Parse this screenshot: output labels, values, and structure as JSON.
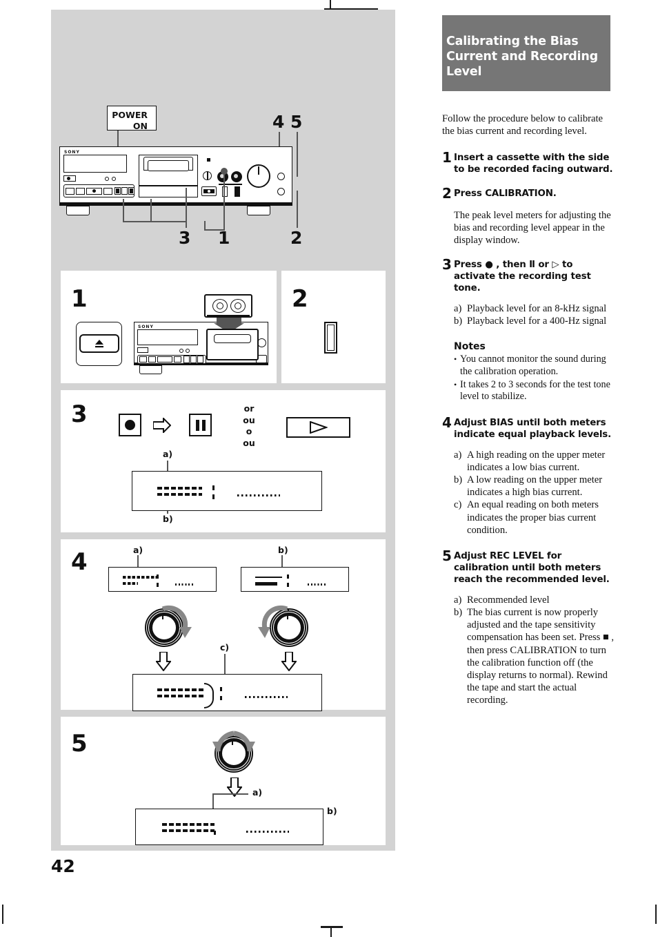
{
  "page": {
    "number": "42",
    "header_bg": "#767676",
    "panel_bg": "#d3d3d3"
  },
  "chapter": {
    "title": "Calibrating the Bias Current and Recording Level"
  },
  "intro": "Follow the procedure below to calibrate the bias current and recording level.",
  "steps": [
    {
      "n": "1",
      "title": "Insert a cassette with the side to be recorded facing outward."
    },
    {
      "n": "2",
      "title": "Press CALIBRATION.",
      "body": "The peak level meters for adjusting the bias and recording level appear in the display window."
    },
    {
      "n": "3",
      "title": "Press ● , then Ⅱ or ▷ to activate the recording test tone.",
      "sublist": [
        {
          "label": "a)",
          "text": "Playback level for an 8-kHz signal"
        },
        {
          "label": "b)",
          "text": "Playback level for a 400-Hz signal"
        }
      ]
    },
    {
      "n": "4",
      "title": "Adjust BIAS until both meters indicate equal playback levels.",
      "sublist": [
        {
          "label": "a)",
          "text": "A high reading on the upper meter indicates a low bias current."
        },
        {
          "label": "b)",
          "text": "A low reading on the upper meter indicates a high bias current."
        },
        {
          "label": "c)",
          "text": "An equal reading on both meters indicates the proper bias current condition."
        }
      ]
    },
    {
      "n": "5",
      "title": "Adjust REC LEVEL for calibration until both meters reach the recommended level.",
      "sublist": [
        {
          "label": "a)",
          "text": "Recommended level"
        },
        {
          "label": "b)",
          "text": "The bias current is now properly adjusted and the tape sensitivity compensation has been set. Press ■ , then press CALIBRATION to turn the calibration function off (the display returns to normal). Rewind the tape and start the actual recording."
        }
      ]
    }
  ],
  "notes": {
    "heading": "Notes",
    "items": [
      "You cannot monitor the sound during the calibration operation.",
      "It takes 2 to 3 seconds for the test tone level to stabilize."
    ]
  },
  "diagram": {
    "power_label_line1": "POWER",
    "power_label_line2": "ON",
    "brand": "SONY",
    "callouts": [
      "4",
      "5",
      "3",
      "1",
      "2"
    ],
    "panels": {
      "p1": {
        "num": "1"
      },
      "p2": {
        "num": "2"
      },
      "p3": {
        "num": "3",
        "or_lines": [
          "or",
          "ou",
          "o",
          "ou"
        ],
        "record_icon": "record-dot-icon",
        "arrow_icon": "right-arrow-icon",
        "pause_icon": "pause-icon",
        "play_icon": "play-triangle-icon",
        "label_a": "a)",
        "label_b": "b)"
      },
      "p4": {
        "num": "4",
        "label_a": "a)",
        "label_b": "b)",
        "label_c": "c)"
      },
      "p5": {
        "num": "5",
        "label_a": "a)",
        "label_b": "b)"
      }
    }
  }
}
